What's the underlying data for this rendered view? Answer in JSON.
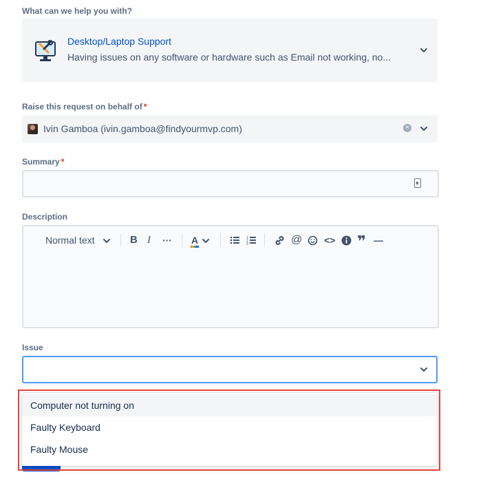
{
  "request_type": {
    "heading": "What can we help you with?",
    "title": "Desktop/Laptop Support",
    "description": "Having issues on any software or hardware such as Email not working, no..."
  },
  "behalf": {
    "label": "Raise this request on behalf of",
    "required_mark": "*",
    "value": "Ivin Gamboa (ivin.gamboa@findyourmvp.com)"
  },
  "summary": {
    "label": "Summary",
    "required_mark": "*",
    "value": ""
  },
  "description": {
    "label": "Description",
    "toolbar": {
      "text_style": "Normal text",
      "bold": "B",
      "italic": "I",
      "more": "···",
      "text_color": "A",
      "link_icon": "link-icon",
      "mention": "@",
      "emoji_icon": "emoji-icon",
      "code": "<>",
      "info_icon": "info-icon",
      "quote": "❞",
      "divider": "—"
    }
  },
  "issue": {
    "label": "Issue",
    "value": "",
    "options": [
      {
        "label": "Computer not turning on",
        "active": true
      },
      {
        "label": "Faulty Keyboard",
        "active": false
      },
      {
        "label": "Faulty Mouse",
        "active": false
      }
    ]
  },
  "colors": {
    "link": "#0052cc",
    "focus_border": "#4c9aff",
    "highlight": "#e5423f",
    "required": "#de350b"
  }
}
